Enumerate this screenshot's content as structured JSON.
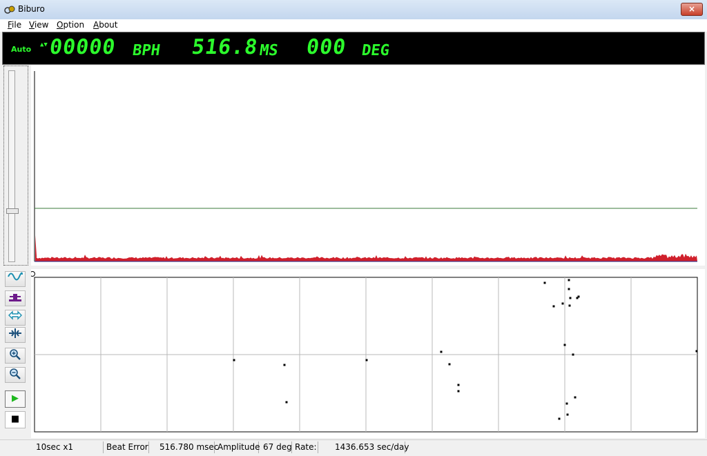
{
  "window": {
    "title": "Biburo",
    "close_label": "×"
  },
  "menu": [
    {
      "label": "File",
      "accel": "F",
      "rest": "ile"
    },
    {
      "label": "View",
      "accel": "V",
      "rest": "iew"
    },
    {
      "label": "Option",
      "accel": "O",
      "rest": "ption"
    },
    {
      "label": "About",
      "accel": "A",
      "rest": "bout"
    }
  ],
  "lcd": {
    "mode": "Auto",
    "arrows": "▲▼",
    "bph_value": "00000",
    "bph_unit": "BPH",
    "ms_value": "516.8",
    "ms_unit": "MS",
    "deg_value": "000",
    "deg_unit": "DEG",
    "color": "#2cff2c"
  },
  "waveform": {
    "threshold_color": "#3a7a3a",
    "trace_color": "#d0202c",
    "slider_level": 0.73
  },
  "toolbar": [
    {
      "name": "waveform-tool-button",
      "icon": "sine-wave-icon"
    },
    {
      "name": "threshold-tool-button",
      "icon": "threshold-icon"
    },
    {
      "name": "expand-tool-button",
      "icon": "expand-arrows-icon"
    },
    {
      "name": "shrink-tool-button",
      "icon": "shrink-arrows-icon"
    },
    {
      "name": "zoom-in-button",
      "icon": "zoom-in-icon"
    },
    {
      "name": "zoom-out-button",
      "icon": "zoom-out-icon"
    },
    {
      "name": "play-button",
      "icon": "play-icon",
      "glyph": "▶",
      "color": "#1fb81f"
    },
    {
      "name": "stop-button",
      "icon": "stop-icon",
      "glyph": "■",
      "color": "#000000"
    }
  ],
  "status": {
    "scale": "10sec x1",
    "beat_error_label": "Beat Error",
    "beat_error_value": "516.780 msec",
    "amplitude_label": "Amplitude",
    "amplitude_value": "67 deg",
    "rate_label": "Rate:",
    "rate_value": "1436.653 sec/day"
  }
}
